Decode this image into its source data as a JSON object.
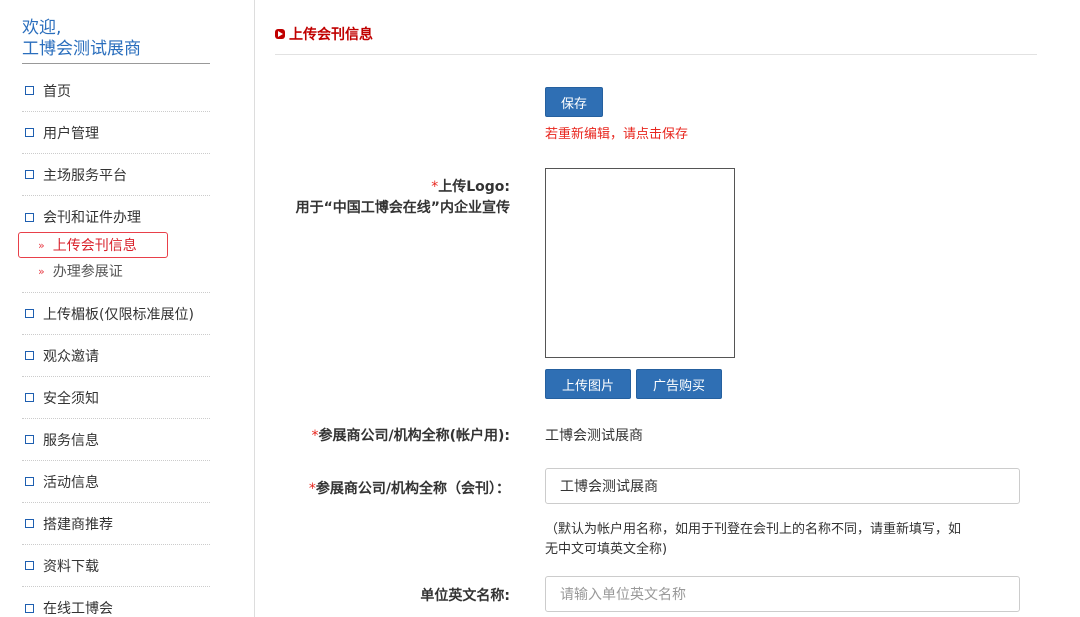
{
  "sidebar": {
    "welcome_line1": "欢迎,",
    "welcome_line2": "工博会测试展商",
    "items": [
      {
        "label": "首页"
      },
      {
        "label": "用户管理"
      },
      {
        "label": "主场服务平台"
      },
      {
        "label": "会刊和证件办理",
        "children": [
          {
            "label": "上传会刊信息",
            "active": true
          },
          {
            "label": "办理参展证"
          }
        ]
      },
      {
        "label": "上传楣板(仅限标准展位)"
      },
      {
        "label": "观众邀请"
      },
      {
        "label": "安全须知"
      },
      {
        "label": "服务信息"
      },
      {
        "label": "活动信息"
      },
      {
        "label": "搭建商推荐"
      },
      {
        "label": "资料下载"
      },
      {
        "label": "在线工博会"
      }
    ]
  },
  "main": {
    "section_title": "上传会刊信息",
    "save_button": "保存",
    "save_note": "若重新编辑，请点击保存",
    "logo_label_required": "*",
    "logo_label": "上传Logo:",
    "logo_label_sub": "用于“中国工博会在线”内企业宣传",
    "upload_image_button": "上传图片",
    "ad_purchase_button": "广告购买",
    "account_name_required": "*",
    "account_name_label": "参展商公司/机构全称(帐户用):",
    "account_name_value": "工博会测试展商",
    "catalog_name_required": "*",
    "catalog_name_label": "参展商公司/机构全称（会刊）：",
    "catalog_name_value": "工博会测试展商",
    "catalog_name_hint_line1": "（默认为帐户用名称，如用于刊登在会刊上的名称不同，请重新填写，如",
    "catalog_name_hint_line2": "无中文可填英文全称)",
    "english_name_label": "单位英文名称:",
    "english_name_placeholder": "请输入单位英文名称"
  },
  "colors": {
    "accent_blue": "#2f6fb4",
    "title_red": "#c00000",
    "warning_red": "#e8261e"
  }
}
